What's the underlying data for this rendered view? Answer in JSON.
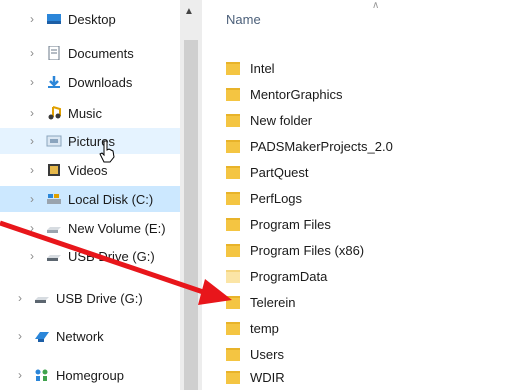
{
  "nav": {
    "items": [
      {
        "label": "Desktop",
        "icon": "desktop-icon"
      },
      {
        "label": "Documents",
        "icon": "documents-icon"
      },
      {
        "label": "Downloads",
        "icon": "downloads-icon"
      },
      {
        "label": "Music",
        "icon": "music-icon"
      },
      {
        "label": "Pictures",
        "icon": "pictures-icon"
      },
      {
        "label": "Videos",
        "icon": "videos-icon"
      },
      {
        "label": "Local Disk (C:)",
        "icon": "drive-icon"
      },
      {
        "label": "New Volume (E:)",
        "icon": "drive-icon"
      },
      {
        "label": "USB Drive (G:)",
        "icon": "usb-drive-icon"
      },
      {
        "label": "USB Drive (G:)",
        "icon": "usb-drive-icon"
      },
      {
        "label": "Network",
        "icon": "network-icon"
      },
      {
        "label": "Homegroup",
        "icon": "homegroup-icon"
      }
    ]
  },
  "main": {
    "column_header": "Name",
    "folders": [
      "Intel",
      "MentorGraphics",
      "New folder",
      "PADSMakerProjects_2.0",
      "PartQuest",
      "PerfLogs",
      "Program Files",
      "Program Files (x86)",
      "ProgramData",
      "Telerein",
      "temp",
      "Users",
      "WDIR"
    ]
  },
  "colors": {
    "selection": "#cce8ff",
    "hover": "#e5f3ff",
    "arrow": "#e8161b",
    "folder": "#f4c542"
  }
}
